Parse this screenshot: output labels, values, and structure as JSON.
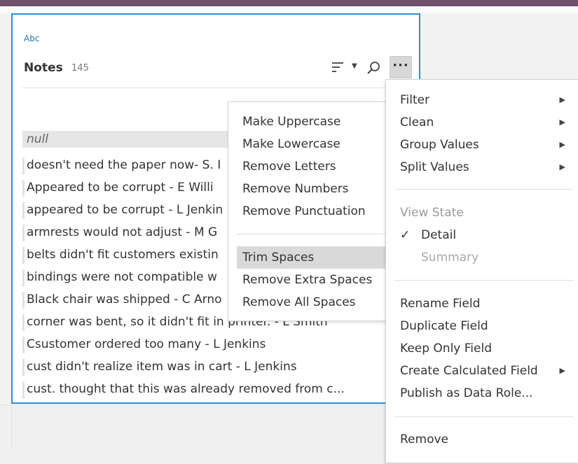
{
  "field": {
    "type_label": "Abc",
    "name": "Notes",
    "count": "145"
  },
  "values": [
    "null",
    " doesn't need the paper now- S. I",
    "Appeared to be corrupt - E  Willi",
    "appeared to be corrupt - L Jenkin",
    "armrests would not adjust - M G",
    "belts didn't fit customers existin",
    "bindings were not compatible w",
    "Black chair was shipped - C Arno",
    "corner was bent, so it didn't fit in printer. - L Smith",
    "Csustomer ordered too many - L Jenkins",
    "cust didn't realize item was in cart - L Jenkins",
    "cust. thought that this was already removed from c..."
  ],
  "clean_submenu": {
    "items": [
      "Make Uppercase",
      "Make Lowercase",
      "Remove Letters",
      "Remove Numbers",
      "Remove Punctuation",
      "Trim Spaces",
      "Remove Extra Spaces",
      "Remove All Spaces"
    ],
    "highlighted": "Trim Spaces"
  },
  "main_menu": {
    "filter": "Filter",
    "clean": "Clean",
    "group_values": "Group Values",
    "split_values": "Split Values",
    "view_state_header": "View State",
    "detail": "Detail",
    "detail_check": "✓",
    "summary": "Summary",
    "rename_field": "Rename Field",
    "duplicate_field": "Duplicate Field",
    "keep_only_field": "Keep Only Field",
    "create_calculated_field": "Create Calculated Field",
    "publish_as_data_role": "Publish as Data Role...",
    "remove": "Remove"
  },
  "icons": {
    "sort": "sort-icon",
    "sort_caret": "caret-down-icon",
    "search": "search-icon",
    "more": "more-options-icon",
    "submenu_arrow": "submenu-arrow-icon",
    "check": "checkmark-icon"
  },
  "colors": {
    "card_border": "#2d8ed6",
    "top_bar": "#70506a",
    "highlight": "#d9d9d9"
  }
}
